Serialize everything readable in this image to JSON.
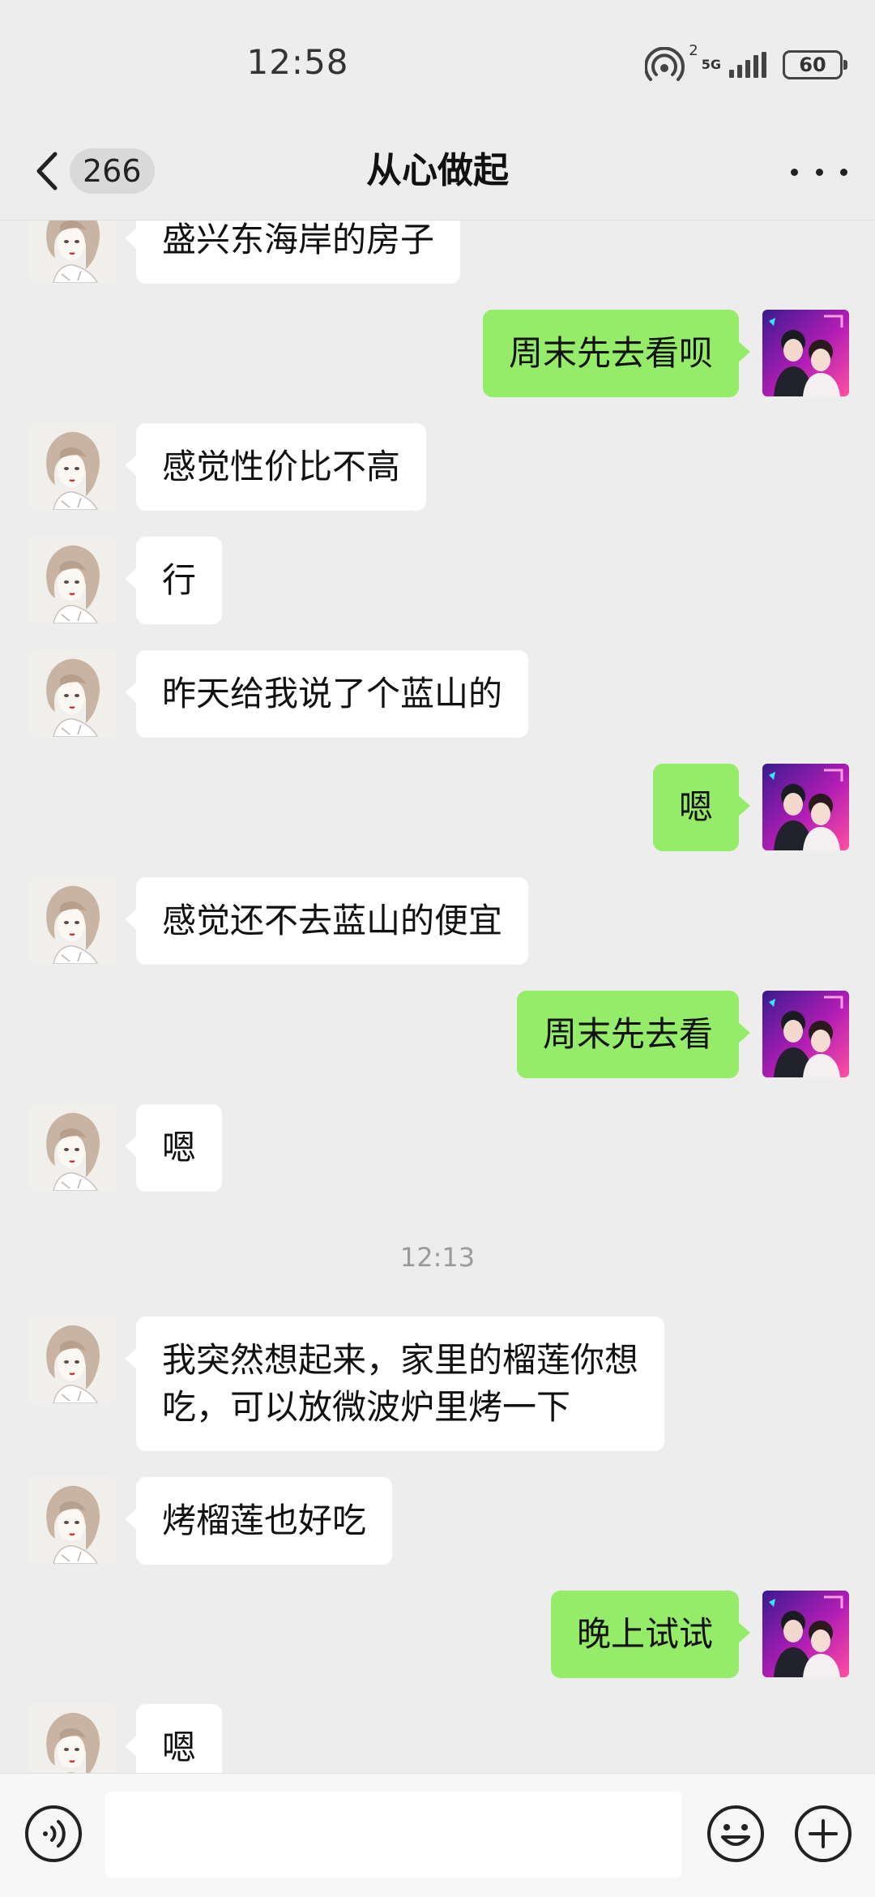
{
  "status_bar": {
    "time": "12:58",
    "hotspot_count": "2",
    "network": "5G",
    "battery": "60"
  },
  "nav": {
    "unread_count": "266",
    "title": "从心做起"
  },
  "messages": [
    {
      "side": "left",
      "text": "盛兴东海岸的房子"
    },
    {
      "side": "right",
      "text": "周末先去看呗"
    },
    {
      "side": "left",
      "text": "感觉性价比不高"
    },
    {
      "side": "left",
      "text": "行"
    },
    {
      "side": "left",
      "text": "昨天给我说了个蓝山的"
    },
    {
      "side": "right",
      "text": "嗯"
    },
    {
      "side": "left",
      "text": "感觉还不去蓝山的便宜"
    },
    {
      "side": "right",
      "text": "周末先去看"
    },
    {
      "side": "left",
      "text": "嗯"
    },
    {
      "timestamp": "12:13"
    },
    {
      "side": "left",
      "text": "我突然想起来，家里的榴莲你想\n吃，可以放微波炉里烤一下"
    },
    {
      "side": "left",
      "text": "烤榴莲也好吃"
    },
    {
      "side": "right",
      "text": "晚上试试"
    },
    {
      "side": "left",
      "text": "嗯"
    }
  ],
  "input": {
    "value": "",
    "placeholder": ""
  },
  "colors": {
    "background": "#ededed",
    "sent_bubble": "#95ec69",
    "received_bubble": "#ffffff"
  }
}
